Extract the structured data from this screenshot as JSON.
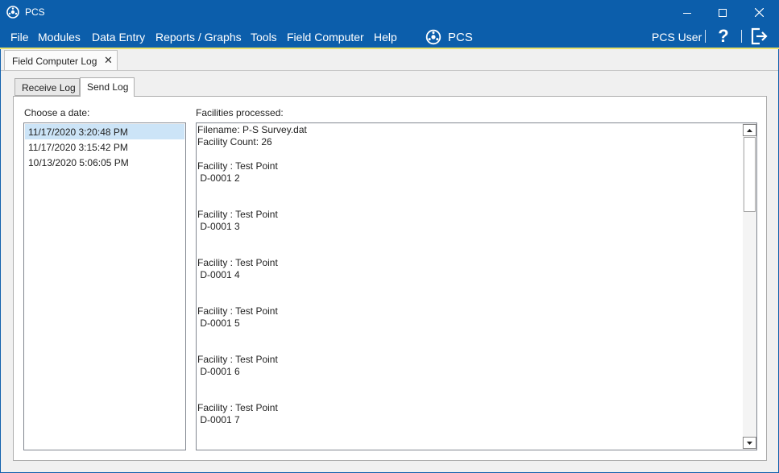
{
  "window": {
    "title": "PCS",
    "icon": "pcs-app-icon"
  },
  "menu": [
    "File",
    "Modules",
    "Data Entry",
    "Reports / Graphs",
    "Tools",
    "Field Computer",
    "Help"
  ],
  "logo_text": "PCS",
  "user": "PCS User",
  "help_label": "?",
  "doc_tab": {
    "label": "Field Computer Log",
    "close": "✕"
  },
  "tabs": [
    {
      "label": "Receive Log",
      "selected": false
    },
    {
      "label": "Send Log",
      "selected": true
    }
  ],
  "choose_date_label": "Choose a date:",
  "dates": [
    "11/17/2020 3:20:48 PM",
    "11/17/2020 3:15:42 PM",
    "10/13/2020 5:06:05 PM"
  ],
  "selected_date_index": 0,
  "facilities_label": "Facilities processed:",
  "log": "Filename: P-S Survey.dat\nFacility Count: 26\n\nFacility : Test Point\n D-0001 2\n\n\nFacility : Test Point\n D-0001 3\n\n\nFacility : Test Point\n D-0001 4\n\n\nFacility : Test Point\n D-0001 5\n\n\nFacility : Test Point\n D-0001 6\n\n\nFacility : Test Point\n D-0001 7",
  "colors": {
    "titlebar": "#0c5eab",
    "accent": "#e8e16b",
    "selection": "#cce4f7"
  }
}
